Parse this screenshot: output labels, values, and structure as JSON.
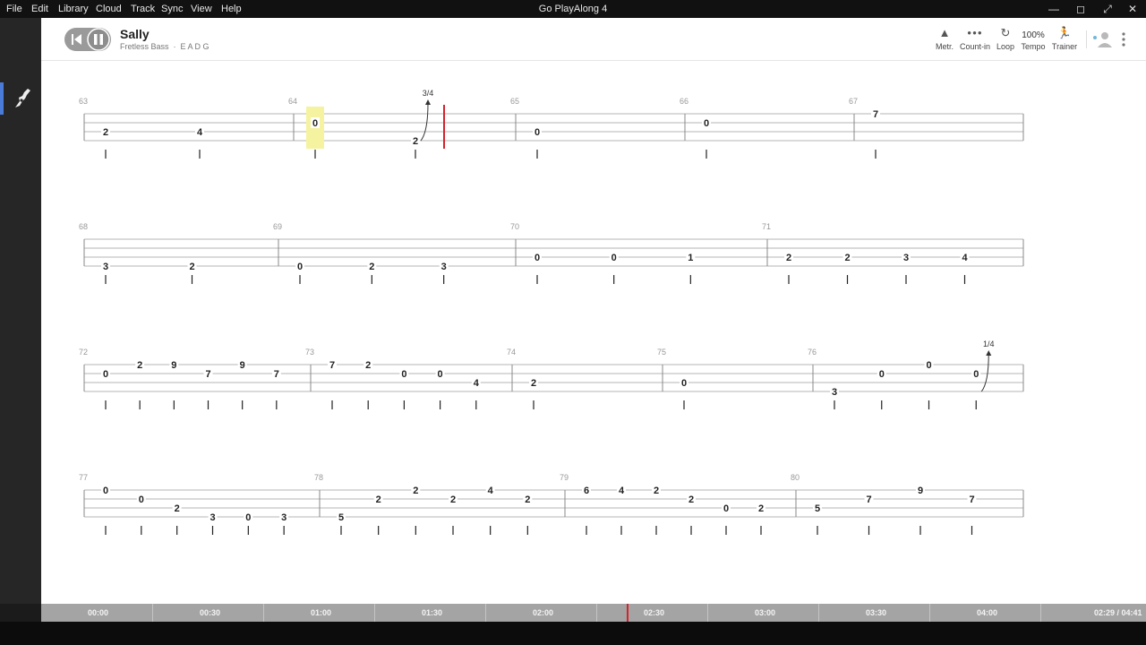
{
  "menu": [
    "File",
    "Edit",
    "Library",
    "Cloud",
    "Track",
    "Sync",
    "View",
    "Help"
  ],
  "window_title": "Go PlayAlong 4",
  "song": {
    "title": "Sally",
    "instrument": "Fretless Bass",
    "tuning": "E A D G"
  },
  "toolbar": {
    "metronome": "Metr.",
    "count_in": "Count-in",
    "loop": "Loop",
    "tempo_value": "100%",
    "tempo": "Tempo",
    "trainer": "Trainer"
  },
  "timeline": {
    "labels": [
      "00:00",
      "00:30",
      "01:00",
      "01:30",
      "02:00",
      "02:30",
      "03:00",
      "03:30",
      "04:00"
    ],
    "position": "02:29 / 04:41",
    "progress": 0.53
  },
  "score": {
    "systems": [
      {
        "measures": [
          {
            "num": "63",
            "notes": [
              {
                "fret": "2",
                "string": 2
              },
              {
                "fret": "4",
                "string": 2
              }
            ]
          },
          {
            "num": "64",
            "highlight": true,
            "notes": [
              {
                "fret": "0",
                "string": 1
              },
              {
                "fret": "2",
                "string": 3
              }
            ],
            "bend": "3/4"
          },
          {
            "num": "65",
            "notes": [
              {
                "fret": "0",
                "string": 2
              }
            ]
          },
          {
            "num": "66",
            "notes": [
              {
                "fret": "0",
                "string": 1
              }
            ]
          },
          {
            "num": "67",
            "notes": [
              {
                "fret": "7",
                "string": 0
              }
            ]
          }
        ]
      },
      {
        "measures": [
          {
            "num": "68",
            "notes": [
              {
                "fret": "3",
                "string": 3
              },
              {
                "fret": "2",
                "string": 3
              }
            ]
          },
          {
            "num": "69",
            "notes": [
              {
                "fret": "0",
                "string": 3
              },
              {
                "fret": "2",
                "string": 3
              },
              {
                "fret": "3",
                "string": 3
              }
            ]
          },
          {
            "num": "70",
            "notes": [
              {
                "fret": "0",
                "string": 2
              },
              {
                "fret": "0",
                "string": 2
              },
              {
                "fret": "1",
                "string": 2
              }
            ]
          },
          {
            "num": "71",
            "notes": [
              {
                "fret": "2",
                "string": 2
              },
              {
                "fret": "2",
                "string": 2
              },
              {
                "fret": "3",
                "string": 2
              },
              {
                "fret": "4",
                "string": 2
              }
            ]
          }
        ]
      },
      {
        "measures": [
          {
            "num": "72",
            "notes": [
              {
                "fret": "0",
                "string": 1
              },
              {
                "fret": "2",
                "string": 0
              },
              {
                "fret": "9",
                "string": 0
              },
              {
                "fret": "7",
                "string": 1
              },
              {
                "fret": "9",
                "string": 0
              },
              {
                "fret": "7",
                "string": 1
              }
            ]
          },
          {
            "num": "73",
            "notes": [
              {
                "fret": "7",
                "string": 0
              },
              {
                "fret": "2",
                "string": 0
              },
              {
                "fret": "0",
                "string": 1
              },
              {
                "fret": "0",
                "string": 1
              },
              {
                "fret": "4",
                "string": 2
              }
            ]
          },
          {
            "num": "74",
            "notes": [
              {
                "fret": "2",
                "string": 2
              }
            ]
          },
          {
            "num": "75",
            "notes": [
              {
                "fret": "0",
                "string": 2
              }
            ]
          },
          {
            "num": "76",
            "notes": [
              {
                "fret": "3",
                "string": 3
              },
              {
                "fret": "0",
                "string": 1
              },
              {
                "fret": "0",
                "string": 0
              },
              {
                "fret": "0",
                "string": 1
              }
            ],
            "bend": "1/4"
          }
        ]
      },
      {
        "measures": [
          {
            "num": "77",
            "notes": [
              {
                "fret": "0",
                "string": 0
              },
              {
                "fret": "0",
                "string": 1
              },
              {
                "fret": "2",
                "string": 2
              },
              {
                "fret": "3",
                "string": 3
              },
              {
                "fret": "0",
                "string": 3
              },
              {
                "fret": "3",
                "string": 3
              }
            ]
          },
          {
            "num": "78",
            "notes": [
              {
                "fret": "5",
                "string": 3
              },
              {
                "fret": "2",
                "string": 1
              },
              {
                "fret": "2",
                "string": 0
              },
              {
                "fret": "2",
                "string": 1
              },
              {
                "fret": "4",
                "string": 0
              },
              {
                "fret": "2",
                "string": 1
              }
            ]
          },
          {
            "num": "79",
            "notes": [
              {
                "fret": "6",
                "string": 0
              },
              {
                "fret": "4",
                "string": 0
              },
              {
                "fret": "2",
                "string": 0
              },
              {
                "fret": "2",
                "string": 1
              },
              {
                "fret": "0",
                "string": 2
              },
              {
                "fret": "2",
                "string": 2
              }
            ]
          },
          {
            "num": "80",
            "notes": [
              {
                "fret": "5",
                "string": 2
              },
              {
                "fret": "7",
                "string": 1
              },
              {
                "fret": "9",
                "string": 0
              },
              {
                "fret": "7",
                "string": 1
              }
            ]
          }
        ]
      }
    ]
  }
}
